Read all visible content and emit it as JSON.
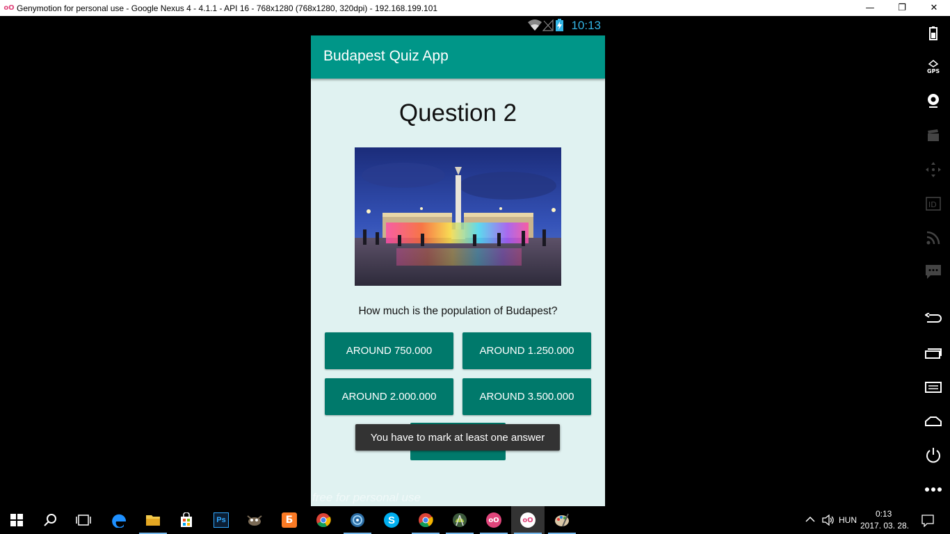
{
  "window": {
    "logo_text": "oO",
    "title": "Genymotion for personal use - Google Nexus 4 - 4.1.1 - API 16 - 768x1280 (768x1280, 320dpi) - 192.168.199.101",
    "minimize_glyph": "—",
    "maximize_glyph": "❐",
    "close_glyph": "✕"
  },
  "status_bar": {
    "time": "10:13",
    "time_color": "#33b5e5"
  },
  "app_bar": {
    "title": "Budapest Quiz App",
    "color": "#009688"
  },
  "quiz": {
    "title": "Question 2",
    "question": "How much is the population of Budapest?",
    "answers": [
      "AROUND 750.000",
      "AROUND 1.250.000",
      "AROUND 2.000.000",
      "AROUND 3.500.000"
    ],
    "answer_color": "#00796b",
    "background": "#e0f2f1"
  },
  "toast": {
    "text": "You have to mark at least one answer"
  },
  "watermark": "free for personal use",
  "sidebar_tools": [
    "battery-icon",
    "gps-icon",
    "webcam-icon",
    "capture-icon",
    "dpad-icon",
    "id-icon",
    "rss-icon",
    "sms-icon",
    "back-icon",
    "recent-apps-icon",
    "menu-icon",
    "home-icon",
    "power-icon",
    "more-icon"
  ],
  "taskbar": {
    "apps": [
      "windows-start-icon",
      "search-icon",
      "task-view-icon",
      "edge-icon",
      "file-explorer-icon",
      "store-icon",
      "photoshop-icon",
      "gimp-icon",
      "xampp-icon",
      "chrome-icon",
      "network-app-icon",
      "skype-icon",
      "chrome-icon",
      "android-studio-icon",
      "genymotion-icon",
      "genymotion-icon",
      "paint-icon"
    ],
    "photoshop_label": "Ps",
    "xampp_label": "Ƃ",
    "skype_label": "S",
    "genymotion_label": "oO",
    "language": "HUN",
    "time": "0:13",
    "date": "2017. 03. 28."
  }
}
